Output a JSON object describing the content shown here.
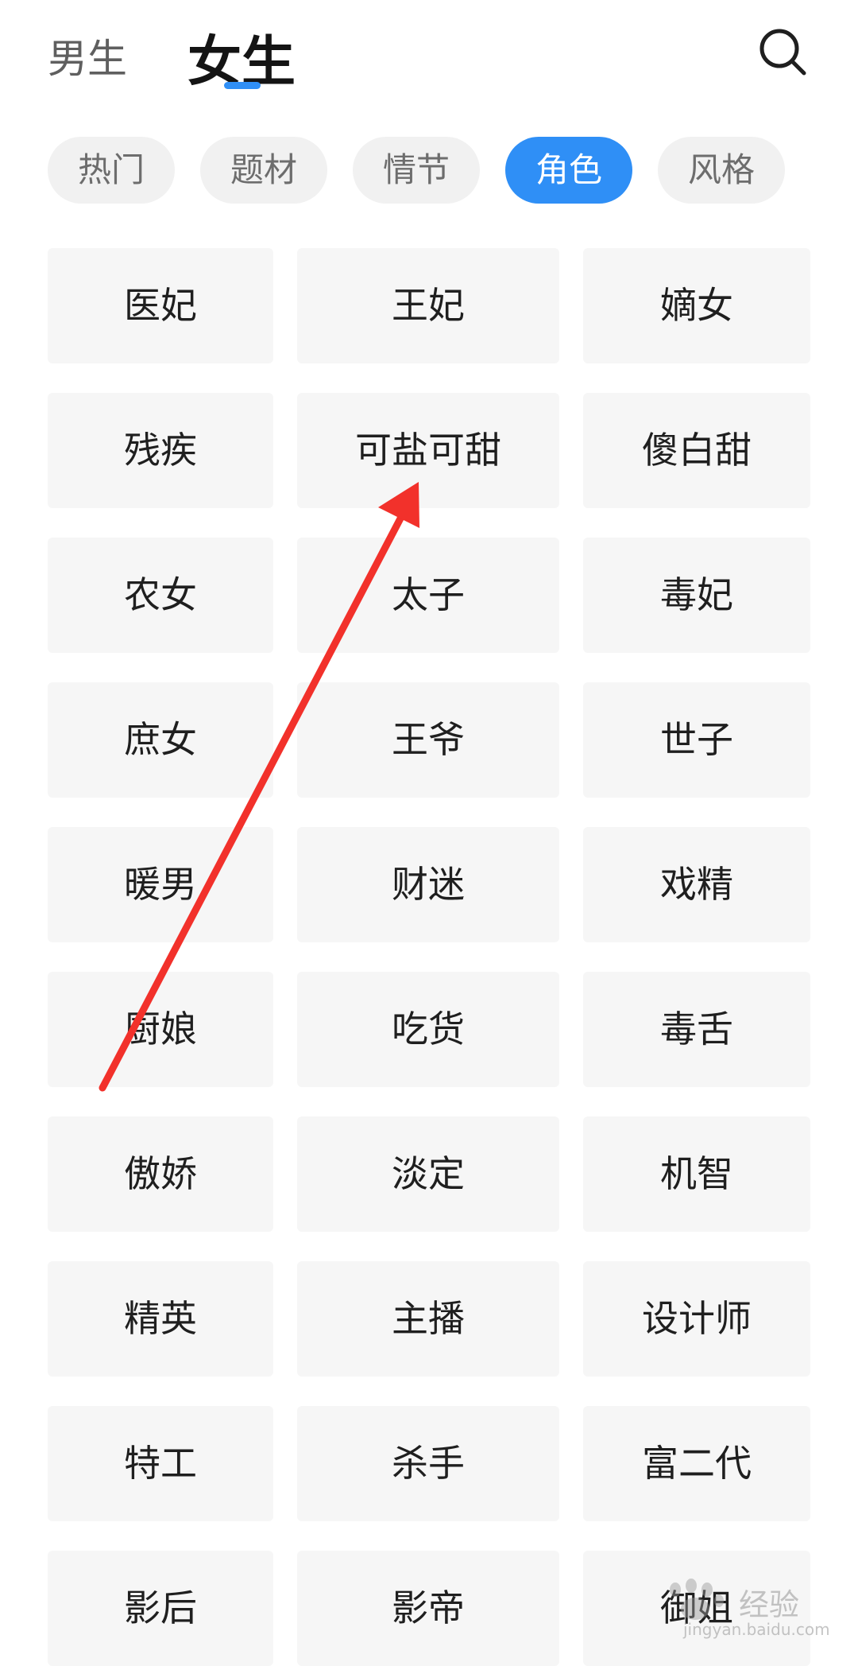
{
  "header": {
    "tabs": [
      {
        "label": "男生",
        "active": false
      },
      {
        "label": "女生",
        "active": true
      }
    ],
    "search_icon": "search-icon"
  },
  "chips": [
    {
      "label": "热门",
      "active": false
    },
    {
      "label": "题材",
      "active": false
    },
    {
      "label": "情节",
      "active": false
    },
    {
      "label": "角色",
      "active": true
    },
    {
      "label": "风格",
      "active": false
    }
  ],
  "tags": [
    [
      "医妃",
      "王妃",
      "嫡女"
    ],
    [
      "残疾",
      "可盐可甜",
      "傻白甜"
    ],
    [
      "农女",
      "太子",
      "毒妃"
    ],
    [
      "庶女",
      "王爷",
      "世子"
    ],
    [
      "暖男",
      "财迷",
      "戏精"
    ],
    [
      "厨娘",
      "吃货",
      "毒舌"
    ],
    [
      "傲娇",
      "淡定",
      "机智"
    ],
    [
      "精英",
      "主播",
      "设计师"
    ],
    [
      "特工",
      "杀手",
      "富二代"
    ],
    [
      "影后",
      "影帝",
      "御姐"
    ]
  ],
  "watermark": {
    "text": "经验",
    "sub": "jingyan.baidu.com"
  },
  "colors": {
    "accent": "#2f8ff6",
    "annotation": "#f2312b"
  }
}
